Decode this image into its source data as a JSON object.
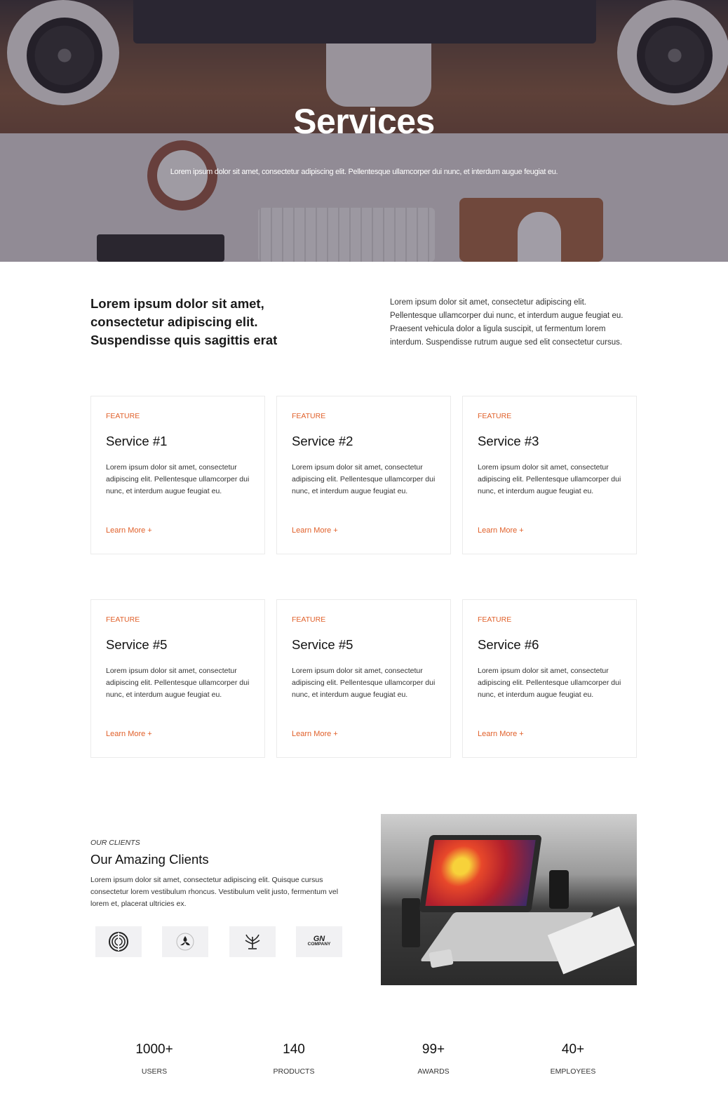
{
  "hero": {
    "title": "Services",
    "subtitle": "Lorem ipsum dolor sit amet, consectetur adipiscing elit. Pellentesque ullamcorper dui nunc, et interdum augue feugiat eu."
  },
  "intro": {
    "heading": "Lorem ipsum dolor sit amet, consectetur adipiscing elit. Suspendisse quis sagittis erat",
    "body": "Lorem ipsum dolor sit amet, consectetur adipiscing elit. Pellentesque ullamcorper dui nunc, et interdum augue feugiat eu. Praesent vehicula dolor a ligula suscipit, ut fermentum lorem interdum. Suspendisse rutrum augue sed elit consectetur cursus."
  },
  "services": [
    {
      "tag": "FEATURE",
      "title": "Service #1",
      "desc": "Lorem ipsum dolor sit amet, consectetur adipiscing elit. Pellentesque ullamcorper dui nunc, et interdum augue feugiat eu.",
      "link": "Learn More +"
    },
    {
      "tag": "FEATURE",
      "title": "Service #2",
      "desc": "Lorem ipsum dolor sit amet, consectetur adipiscing elit. Pellentesque ullamcorper dui nunc, et interdum augue feugiat eu.",
      "link": "Learn More +"
    },
    {
      "tag": "FEATURE",
      "title": "Service #3",
      "desc": "Lorem ipsum dolor sit amet, consectetur adipiscing elit. Pellentesque ullamcorper dui nunc, et interdum augue feugiat eu.",
      "link": "Learn More +"
    },
    {
      "tag": "FEATURE",
      "title": "Service #5",
      "desc": "Lorem ipsum dolor sit amet, consectetur adipiscing elit. Pellentesque ullamcorper dui nunc, et interdum augue feugiat eu.",
      "link": "Learn More +"
    },
    {
      "tag": "FEATURE",
      "title": "Service #5",
      "desc": "Lorem ipsum dolor sit amet, consectetur adipiscing elit. Pellentesque ullamcorper dui nunc, et interdum augue feugiat eu.",
      "link": "Learn More +"
    },
    {
      "tag": "FEATURE",
      "title": "Service #6",
      "desc": "Lorem ipsum dolor sit amet, consectetur adipiscing elit. Pellentesque ullamcorper dui nunc, et interdum augue feugiat eu.",
      "link": "Learn More +"
    }
  ],
  "clients": {
    "kicker": "OUR CLIENTS",
    "title": "Our Amazing Clients",
    "body": "Lorem ipsum dolor sit amet, consectetur adipiscing elit. Quisque cursus consectetur lorem vestibulum rhoncus. Vestibulum velit justo, fermentum vel lorem et, placerat ultricies ex.",
    "logos": [
      {
        "icon": "concentric-circle-logo-icon"
      },
      {
        "icon": "triskelion-logo-icon"
      },
      {
        "icon": "plant-crown-logo-icon"
      },
      {
        "icon": "company-wordmark-logo-icon",
        "mark": "GN",
        "text": "COMPANY"
      }
    ]
  },
  "stats": [
    {
      "value": "1000+",
      "label": "USERS"
    },
    {
      "value": "140",
      "label": "PRODUCTS"
    },
    {
      "value": "99+",
      "label": "AWARDS"
    },
    {
      "value": "40+",
      "label": "EMPLOYEES"
    }
  ],
  "colors": {
    "accent": "#e0602a",
    "text": "#111111",
    "border": "#ebebeb"
  }
}
